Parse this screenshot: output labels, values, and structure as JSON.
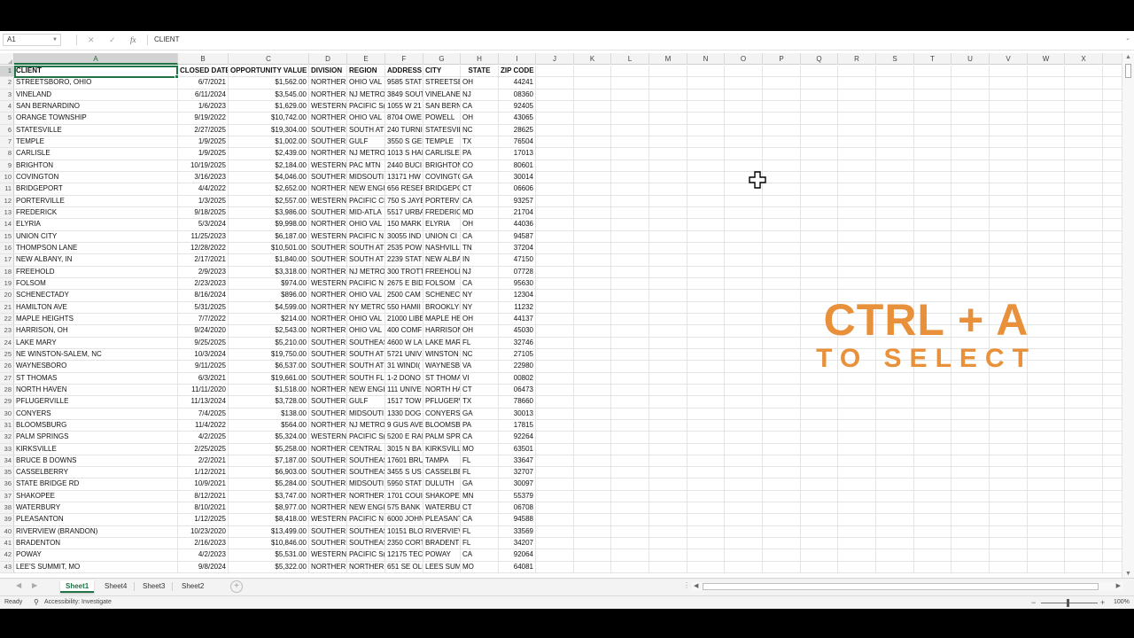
{
  "formula_bar": {
    "name_box": "A1",
    "formula_icon": "fx",
    "formula": "CLIENT"
  },
  "columns": [
    "A",
    "B",
    "C",
    "D",
    "E",
    "F",
    "G",
    "H",
    "I",
    "J",
    "K",
    "L",
    "M",
    "N",
    "O",
    "P",
    "Q",
    "R",
    "S",
    "T",
    "U",
    "V",
    "W",
    "X"
  ],
  "header": {
    "client": "CLIENT",
    "closed_date": "CLOSED DATE",
    "opportunity_value": "OPPORTUNITY VALUE",
    "division": "DIVISION",
    "region": "REGION",
    "address": "ADDRESS",
    "city": "CITY",
    "state": "STATE",
    "zip": "ZIP CODE"
  },
  "rows": [
    {
      "client": "STREETSBORO, OHIO",
      "date": "6/7/2021",
      "value": "$1,562.00",
      "division": "NORTHERI",
      "region": "OHIO VAL",
      "address": "9585 STAT",
      "city": "STREETSBO",
      "state": "OH",
      "zip": "44241"
    },
    {
      "client": "VINELAND",
      "date": "6/11/2024",
      "value": "$3,545.00",
      "division": "NORTHERI",
      "region": "NJ METRO",
      "address": "3849 SOUT",
      "city": "VINELANE",
      "state": "NJ",
      "zip": "08360"
    },
    {
      "client": "SAN BERNARDINO",
      "date": "1/6/2023",
      "value": "$1,629.00",
      "division": "WESTERN",
      "region": "PACIFIC S(",
      "address": "1055 W 21",
      "city": "SAN BERN",
      "state": "CA",
      "zip": "92405"
    },
    {
      "client": "ORANGE TOWNSHIP",
      "date": "9/19/2022",
      "value": "$10,742.00",
      "division": "NORTHERI",
      "region": "OHIO VAL",
      "address": "8704 OWE",
      "city": "POWELL",
      "state": "OH",
      "zip": "43065"
    },
    {
      "client": "STATESVILLE",
      "date": "2/27/2025",
      "value": "$19,304.00",
      "division": "SOUTHERI",
      "region": "SOUTH AT",
      "address": "240 TURNI",
      "city": "STATESVIL",
      "state": "NC",
      "zip": "28625"
    },
    {
      "client": "TEMPLE",
      "date": "1/9/2025",
      "value": "$1,002.00",
      "division": "SOUTHERI",
      "region": "GULF",
      "address": "3550 S GEI",
      "city": "TEMPLE",
      "state": "TX",
      "zip": "76504"
    },
    {
      "client": "CARLISLE",
      "date": "1/9/2025",
      "value": "$2,439.00",
      "division": "NORTHERI",
      "region": "NJ METRO",
      "address": "1013 S HAI",
      "city": "CARLISLE",
      "state": "PA",
      "zip": "17013"
    },
    {
      "client": "BRIGHTON",
      "date": "10/19/2025",
      "value": "$2,184.00",
      "division": "WESTERN",
      "region": "PAC MTN",
      "address": "2440 BUCI",
      "city": "BRIGHTON",
      "state": "CO",
      "zip": "80601"
    },
    {
      "client": "COVINGTON",
      "date": "3/16/2023",
      "value": "$4,046.00",
      "division": "SOUTHERI",
      "region": "MIDSOUTI",
      "address": "13171 HW",
      "city": "COVINGTC",
      "state": "GA",
      "zip": "30014"
    },
    {
      "client": "BRIDGEPORT",
      "date": "4/4/2022",
      "value": "$2,652.00",
      "division": "NORTHERI",
      "region": "NEW ENGI",
      "address": "656 RESER",
      "city": "BRIDGEPC",
      "state": "CT",
      "zip": "06606"
    },
    {
      "client": "PORTERVILLE",
      "date": "1/3/2025",
      "value": "$2,557.00",
      "division": "WESTERN",
      "region": "PACIFIC CI",
      "address": "750 S JAYE",
      "city": "PORTERVI",
      "state": "CA",
      "zip": "93257"
    },
    {
      "client": "FREDERICK",
      "date": "9/18/2025",
      "value": "$3,986.00",
      "division": "SOUTHERI",
      "region": "MID-ATLA",
      "address": "5517 URBA",
      "city": "FREDERICI",
      "state": "MD",
      "zip": "21704"
    },
    {
      "client": "ELYRIA",
      "date": "5/3/2024",
      "value": "$9,998.00",
      "division": "NORTHERI",
      "region": "OHIO VAL",
      "address": "150 MARK",
      "city": "ELYRIA",
      "state": "OH",
      "zip": "44036"
    },
    {
      "client": "UNION CITY",
      "date": "11/25/2023",
      "value": "$6,187.00",
      "division": "WESTERN",
      "region": "PACIFIC N",
      "address": "30055 IND",
      "city": "UNION CI",
      "state": "CA",
      "zip": "94587"
    },
    {
      "client": "THOMPSON LANE",
      "date": "12/28/2022",
      "value": "$10,501.00",
      "division": "SOUTHERI",
      "region": "SOUTH AT",
      "address": "2535 POW",
      "city": "NASHVILL",
      "state": "TN",
      "zip": "37204"
    },
    {
      "client": "NEW ALBANY, IN",
      "date": "2/17/2021",
      "value": "$1,840.00",
      "division": "SOUTHERI",
      "region": "SOUTH AT",
      "address": "2239 STAT",
      "city": "NEW ALBA",
      "state": "IN",
      "zip": "47150"
    },
    {
      "client": "FREEHOLD",
      "date": "2/9/2023",
      "value": "$3,318.00",
      "division": "NORTHERI",
      "region": "NJ METRO",
      "address": "300 TROTT",
      "city": "FREEHOLD",
      "state": "NJ",
      "zip": "07728"
    },
    {
      "client": "FOLSOM",
      "date": "2/23/2023",
      "value": "$974.00",
      "division": "WESTERN",
      "region": "PACIFIC N",
      "address": "2675 E BID",
      "city": "FOLSOM",
      "state": "CA",
      "zip": "95630"
    },
    {
      "client": "SCHENECTADY",
      "date": "8/16/2024",
      "value": "$896.00",
      "division": "NORTHERI",
      "region": "OHIO VAL",
      "address": "2500 CAM",
      "city": "SCHENECT",
      "state": "NY",
      "zip": "12304"
    },
    {
      "client": "HAMILTON AVE",
      "date": "5/31/2025",
      "value": "$4,599.00",
      "division": "NORTHERI",
      "region": "NY METRC",
      "address": "550 HAMII",
      "city": "BROOKLYI",
      "state": "NY",
      "zip": "11232"
    },
    {
      "client": "MAPLE HEIGHTS",
      "date": "7/7/2022",
      "value": "$214.00",
      "division": "NORTHERI",
      "region": "OHIO VAL",
      "address": "21000 LIBE",
      "city": "MAPLE HE",
      "state": "OH",
      "zip": "44137"
    },
    {
      "client": "HARRISON, OH",
      "date": "9/24/2020",
      "value": "$2,543.00",
      "division": "NORTHERI",
      "region": "OHIO VAL",
      "address": "400 COMF",
      "city": "HARRISON",
      "state": "OH",
      "zip": "45030"
    },
    {
      "client": "LAKE MARY",
      "date": "9/25/2025",
      "value": "$5,210.00",
      "division": "SOUTHERI",
      "region": "SOUTHEAS",
      "address": "4600 W LA",
      "city": "LAKE MAR",
      "state": "FL",
      "zip": "32746"
    },
    {
      "client": "NE WINSTON-SALEM, NC",
      "date": "10/3/2024",
      "value": "$19,750.00",
      "division": "SOUTHERI",
      "region": "SOUTH AT",
      "address": "5721 UNIV",
      "city": "WINSTON",
      "state": "NC",
      "zip": "27105"
    },
    {
      "client": "WAYNESBORO",
      "date": "9/11/2025",
      "value": "$6,537.00",
      "division": "SOUTHERI",
      "region": "SOUTH AT",
      "address": "31 WINDI(",
      "city": "WAYNESB",
      "state": "VA",
      "zip": "22980"
    },
    {
      "client": "ST THOMAS",
      "date": "6/3/2021",
      "value": "$19,661.00",
      "division": "SOUTHERI",
      "region": "SOUTH FL",
      "address": "1-2 DONO",
      "city": "ST THOMA",
      "state": "VI",
      "zip": "00802"
    },
    {
      "client": "NORTH HAVEN",
      "date": "11/11/2020",
      "value": "$1,518.00",
      "division": "NORTHERI",
      "region": "NEW ENGI",
      "address": "111 UNIVE",
      "city": "NORTH HA",
      "state": "CT",
      "zip": "06473"
    },
    {
      "client": "PFLUGERVILLE",
      "date": "11/13/2024",
      "value": "$3,728.00",
      "division": "SOUTHERI",
      "region": "GULF",
      "address": "1517 TOW",
      "city": "PFLUGERV",
      "state": "TX",
      "zip": "78660"
    },
    {
      "client": "CONYERS",
      "date": "7/4/2025",
      "value": "$138.00",
      "division": "SOUTHERI",
      "region": "MIDSOUTI",
      "address": "1330 DOG",
      "city": "CONYERS",
      "state": "GA",
      "zip": "30013"
    },
    {
      "client": "BLOOMSBURG",
      "date": "11/4/2022",
      "value": "$564.00",
      "division": "NORTHERI",
      "region": "NJ METRO",
      "address": "9 GUS AVE",
      "city": "BLOOMSB",
      "state": "PA",
      "zip": "17815"
    },
    {
      "client": "PALM SPRINGS",
      "date": "4/2/2025",
      "value": "$5,324.00",
      "division": "WESTERN",
      "region": "PACIFIC S(",
      "address": "5200 E RAI",
      "city": "PALM SPR",
      "state": "CA",
      "zip": "92264"
    },
    {
      "client": "KIRKSVILLE",
      "date": "2/25/2025",
      "value": "$5,258.00",
      "division": "NORTHERI",
      "region": "CENTRAL",
      "address": "3015 N BA",
      "city": "KIRKSVILL",
      "state": "MO",
      "zip": "63501"
    },
    {
      "client": "BRUCE B DOWNS",
      "date": "2/2/2021",
      "value": "$7,187.00",
      "division": "SOUTHERI",
      "region": "SOUTHEAS",
      "address": "17601 BRU",
      "city": "TAMPA",
      "state": "FL",
      "zip": "33647"
    },
    {
      "client": "CASSELBERRY",
      "date": "1/12/2021",
      "value": "$6,903.00",
      "division": "SOUTHERI",
      "region": "SOUTHEAS",
      "address": "3455 S US",
      "city": "CASSELBE",
      "state": "FL",
      "zip": "32707"
    },
    {
      "client": "STATE BRIDGE RD",
      "date": "10/9/2021",
      "value": "$5,284.00",
      "division": "SOUTHERI",
      "region": "MIDSOUTI",
      "address": "5950 STAT",
      "city": "DULUTH",
      "state": "GA",
      "zip": "30097"
    },
    {
      "client": "SHAKOPEE",
      "date": "8/12/2021",
      "value": "$3,747.00",
      "division": "NORTHERI",
      "region": "NORTHERI",
      "address": "1701 COUI",
      "city": "SHAKOPEI",
      "state": "MN",
      "zip": "55379"
    },
    {
      "client": "WATERBURY",
      "date": "8/10/2021",
      "value": "$8,977.00",
      "division": "NORTHERI",
      "region": "NEW ENGI",
      "address": "575 BANK",
      "city": "WATERBU",
      "state": "CT",
      "zip": "06708"
    },
    {
      "client": "PLEASANTON",
      "date": "1/12/2025",
      "value": "$8,418.00",
      "division": "WESTERN",
      "region": "PACIFIC N",
      "address": "6000 JOHN",
      "city": "PLEASANT",
      "state": "CA",
      "zip": "94588"
    },
    {
      "client": "RIVERVIEW (BRANDON)",
      "date": "10/23/2020",
      "value": "$13,499.00",
      "division": "SOUTHERI",
      "region": "SOUTHEAS",
      "address": "10151 BLO",
      "city": "RIVERVIEV",
      "state": "FL",
      "zip": "33569"
    },
    {
      "client": "BRADENTON",
      "date": "2/16/2023",
      "value": "$10,846.00",
      "division": "SOUTHERI",
      "region": "SOUTHEAS",
      "address": "2350 CORT",
      "city": "BRADENTI",
      "state": "FL",
      "zip": "34207"
    },
    {
      "client": "POWAY",
      "date": "4/2/2023",
      "value": "$5,531.00",
      "division": "WESTERN",
      "region": "PACIFIC S(",
      "address": "12175 TEC",
      "city": "POWAY",
      "state": "CA",
      "zip": "92064"
    },
    {
      "client": "LEE'S SUMMIT, MO",
      "date": "9/8/2024",
      "value": "$5,322.00",
      "division": "NORTHERI",
      "region": "NORTHERI",
      "address": "651 SE OLI",
      "city": "LEES SUMI",
      "state": "MO",
      "zip": "64081"
    }
  ],
  "sheet_tabs": [
    "Sheet1",
    "Sheet4",
    "Sheet3",
    "Sheet2"
  ],
  "status": {
    "ready": "Ready",
    "accessibility": "Accessibility: Investigate",
    "zoom": "100%"
  },
  "overlay": {
    "line1": "CTRL + A",
    "line2": "TO SELECT"
  },
  "colors": {
    "excel_green": "#217346",
    "overlay_orange": "#e8913a"
  }
}
